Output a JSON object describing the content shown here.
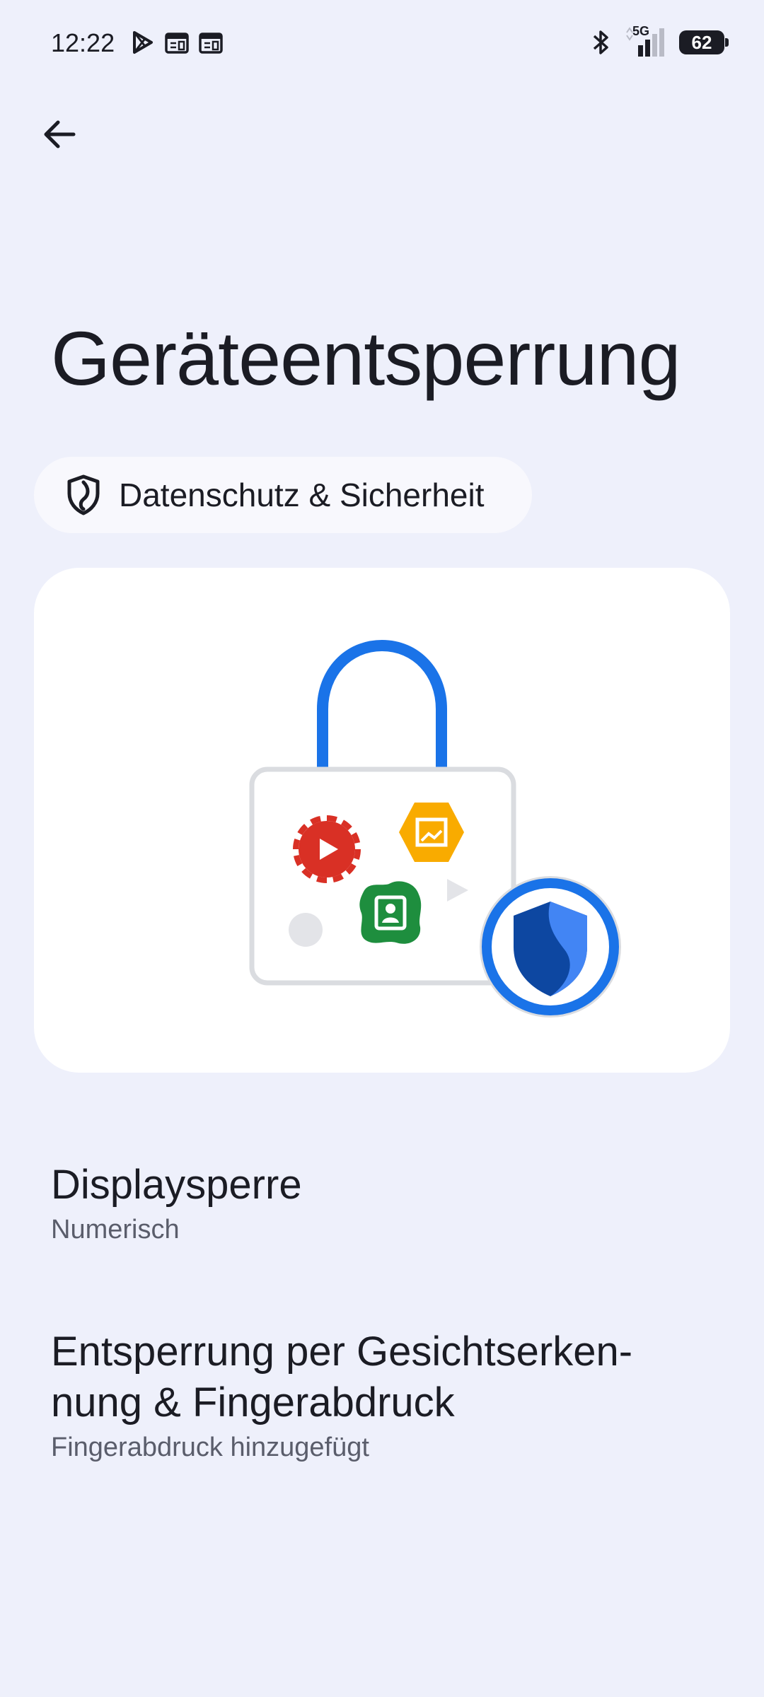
{
  "status_bar": {
    "time": "12:22",
    "network": "5G",
    "battery": "62",
    "left_icons": [
      "play-store-icon",
      "calendar-icon",
      "calendar-icon"
    ],
    "right_icons": [
      "bluetooth-icon",
      "signal-icon",
      "battery-icon"
    ]
  },
  "header": {
    "back_icon": "arrow-back-icon",
    "title": "Geräteentsperrung"
  },
  "category_chip": {
    "icon": "shield-icon",
    "label": "Datenschutz & Sicherheit"
  },
  "illustration": {
    "shackle_color": "#1a73e8",
    "badge_color": "#1a73e8"
  },
  "items": [
    {
      "title": "Displaysperre",
      "subtitle": "Numerisch"
    },
    {
      "title_line1": "Entsperrung per Gesichtserken-",
      "title_line2": "nung & Fingerabdruck",
      "subtitle": "Fingerabdruck hinzugefügt"
    }
  ]
}
